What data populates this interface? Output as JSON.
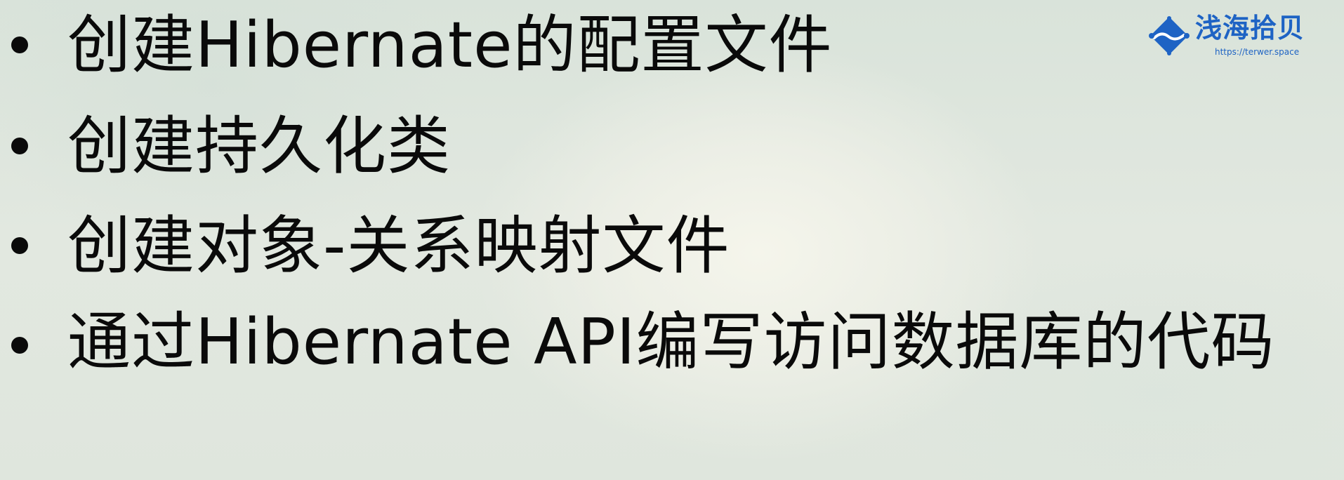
{
  "slide": {
    "bullets": [
      "创建Hibernate的配置文件",
      "创建持久化类",
      "创建对象-关系映射文件",
      "通过Hibernate API编写访问数据库的代码"
    ]
  },
  "watermark": {
    "title": "浅海拾贝",
    "url": "https://terwer.space",
    "logo_icon": "diamond-wave-logo",
    "color": "#1e63c4"
  }
}
